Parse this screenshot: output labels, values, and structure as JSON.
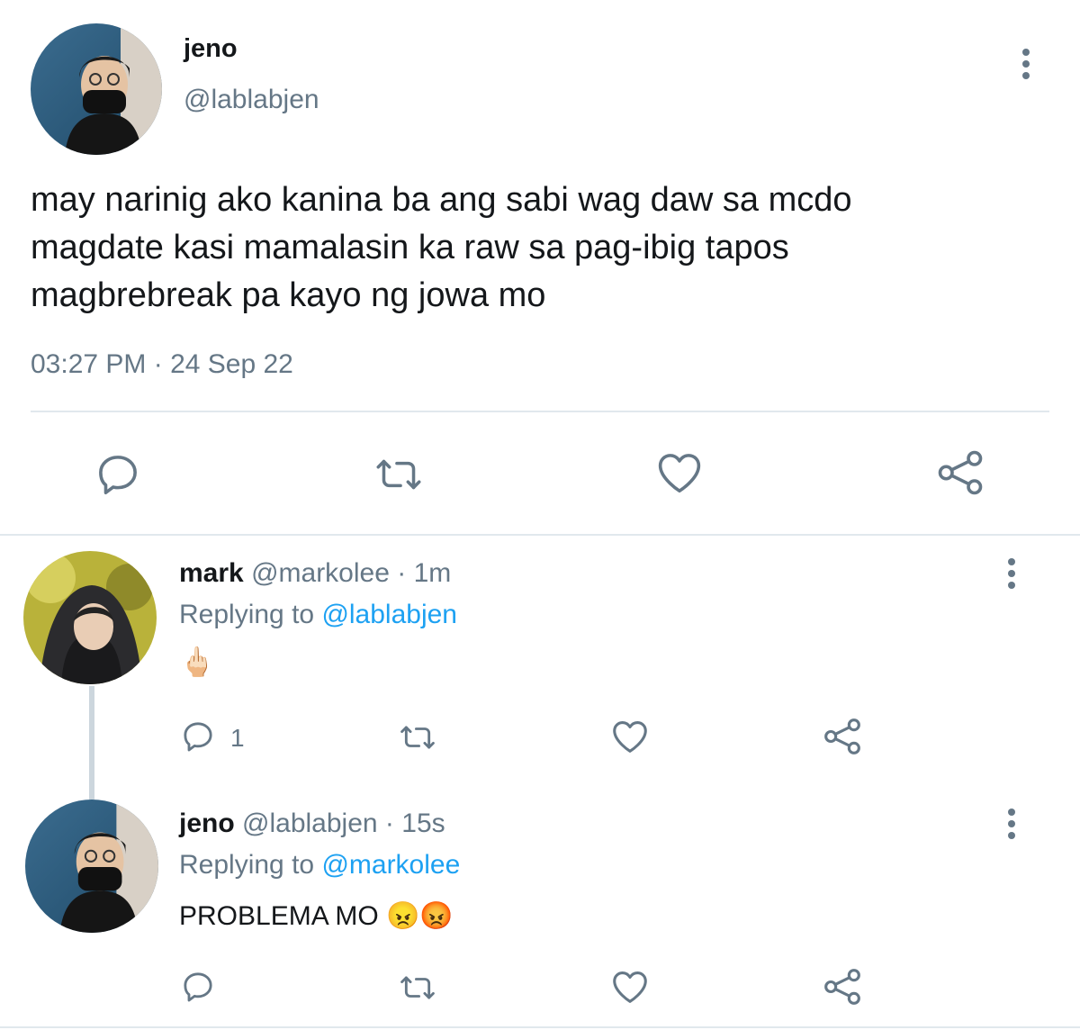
{
  "main_tweet": {
    "display_name": "jeno",
    "handle": "@lablabjen",
    "text_lines": [
      "may narinig ako kanina ba ang sabi wag daw sa mcdo",
      "magdate kasi mamalasin ka raw sa pag-ibig tapos",
      "magbrebreak pa kayo ng jowa mo"
    ],
    "timestamp": "03:27 PM · 24 Sep 22",
    "actions": [
      "reply-icon",
      "retweet-icon",
      "like-icon",
      "share-icon"
    ]
  },
  "replies": [
    {
      "display_name": "mark",
      "handle": "@markolee",
      "time": "1m",
      "sep": "·",
      "replying_prefix": "Replying to ",
      "replying_to": "@lablabjen",
      "text": "🖕🏻",
      "reply_count": "1"
    },
    {
      "display_name": "jeno",
      "handle": "@lablabjen",
      "time": "15s",
      "sep": "·",
      "replying_prefix": "Replying to ",
      "replying_to": "@markolee",
      "text": "PROBLEMA MO 😠😡",
      "reply_count": ""
    }
  ],
  "colors": {
    "text": "#14171a",
    "secondary": "#657786",
    "link": "#1da1f2",
    "divider": "#e1e8ed"
  }
}
